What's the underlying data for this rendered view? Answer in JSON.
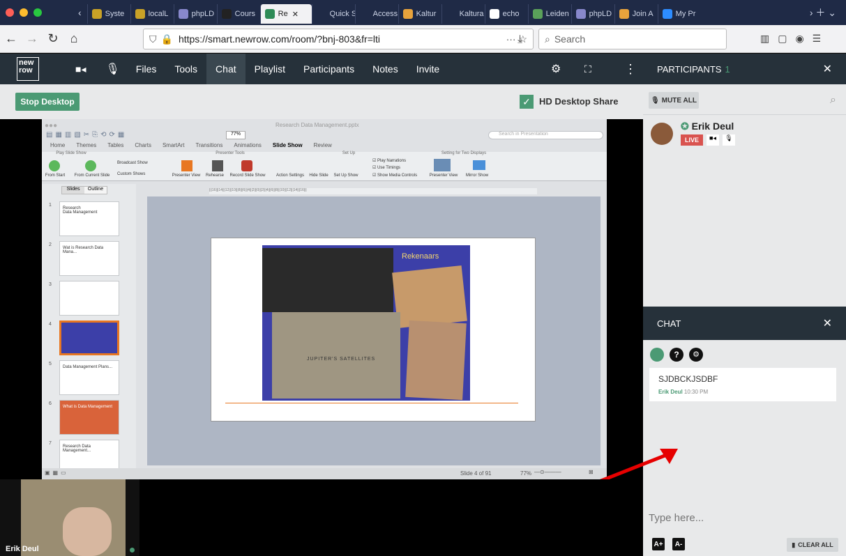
{
  "browser": {
    "tabs": [
      {
        "label": "Syste",
        "color": "#c9a227"
      },
      {
        "label": "localL",
        "color": "#c9a227"
      },
      {
        "label": "phpLD",
        "color": "#8888cc"
      },
      {
        "label": "Cours",
        "color": "#222222"
      },
      {
        "label": "Re",
        "color": "#2e8b57",
        "active": true
      },
      {
        "label": "Quick Star",
        "color": ""
      },
      {
        "label": "Access to",
        "color": ""
      },
      {
        "label": "Kaltur",
        "color": "#e8a33c"
      },
      {
        "label": "Kaltura Liv",
        "color": ""
      },
      {
        "label": "echo",
        "color": "#ffffff"
      },
      {
        "label": "Leiden",
        "color": "#5aa05a"
      },
      {
        "label": "phpLD",
        "color": "#8888cc"
      },
      {
        "label": "Join A",
        "color": "#e8a33c"
      },
      {
        "label": "My Pr",
        "color": "#2d8cff"
      }
    ],
    "url": "https://smart.newrow.com/room/?bnj-803&fr=lti",
    "url_domain": "smart.newrow.com",
    "search_placeholder": "Search"
  },
  "app": {
    "logo": "new\nrow",
    "menu": [
      "Files",
      "Tools",
      "Chat",
      "Playlist",
      "Participants",
      "Notes",
      "Invite"
    ],
    "active_menu": "Chat",
    "stop_desktop": "Stop Desktop",
    "hd_share": "HD Desktop Share",
    "hd_checked": true,
    "accent": "#4b9a74"
  },
  "participants": {
    "title": "PARTICIPANTS",
    "count": "1",
    "mute_all": "MUTE ALL",
    "list": [
      {
        "name": "Erik Deul",
        "live": "LIVE"
      }
    ]
  },
  "chat": {
    "title": "CHAT",
    "messages": [
      {
        "text": "SJDBCKJSDBF",
        "author": "Erik Deul",
        "time": "10:30 PM"
      }
    ],
    "input_placeholder": "Type here...",
    "font_plus": "A+",
    "font_minus": "A-",
    "clear_all": "CLEAR ALL"
  },
  "presentation": {
    "window_title": "Research Data Management.pptx",
    "search_placeholder": "Search in Presentation",
    "zoom": "77%",
    "ribbon_tabs": [
      "Home",
      "Themes",
      "Tables",
      "Charts",
      "SmartArt",
      "Transitions",
      "Animations",
      "Slide Show",
      "Review"
    ],
    "active_ribbon_tab": "Slide Show",
    "ribbon_groups": [
      "Play Slide Show",
      "Presenter Tools",
      "Set Up",
      "Setting for Two Displays"
    ],
    "ribbon_buttons": {
      "from_start": "From Start",
      "from_current": "From Current Slide",
      "broadcast": "Broadcast Show",
      "custom": "Custom Shows",
      "presenter_view": "Presenter View",
      "rehearse": "Rehearse",
      "record": "Record Slide Show",
      "action": "Action Settings",
      "hide": "Hide Slide",
      "setup": "Set Up Show",
      "play_narrations": "Play Narrations",
      "use_timings": "Use Timings",
      "show_media": "Show Media Controls",
      "presenter_view2": "Presenter View",
      "mirror": "Mirror Show"
    },
    "panel_tabs": [
      "Slides",
      "Outline"
    ],
    "thumbnails": [
      {
        "num": "1",
        "text": "Research\nData Management"
      },
      {
        "num": "2",
        "text": "Wat is Research Data Mana..."
      },
      {
        "num": "3",
        "text": ""
      },
      {
        "num": "4",
        "text": ""
      },
      {
        "num": "5",
        "text": "Data Management Plans..."
      },
      {
        "num": "6",
        "text": "What is Data Management"
      },
      {
        "num": "7",
        "text": "Research Data Management..."
      }
    ],
    "slide_title": "Rekenaars",
    "book_title": "JUPITER'S SATELLITES",
    "status": "Slide 4 of 91",
    "status_zoom": "77%"
  },
  "camera": {
    "name": "Erik Deul"
  }
}
